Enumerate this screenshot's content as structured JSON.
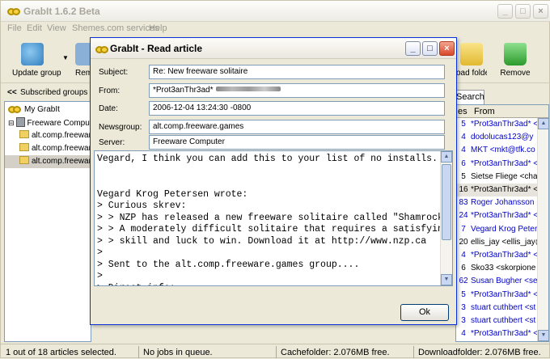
{
  "app": {
    "title": "GrabIt 1.6.2 Beta",
    "menu": [
      "File",
      "Edit",
      "View",
      "Shemes.com services",
      "Help"
    ],
    "toolbar": {
      "update_group": "Update group",
      "remove_partial": "Remo",
      "load_folder": "oad folder",
      "remove": "Remove"
    },
    "left_header": "Subscribed groups",
    "left_header_arrows": "<<",
    "tree": {
      "root": "My GrabIt",
      "server": "Freeware Compute",
      "groups": [
        "alt.comp.freeware",
        "alt.comp.freeware",
        "alt.comp.freeware"
      ]
    },
    "right_tab": "Search",
    "list_headers": {
      "count": "es",
      "from": "From"
    },
    "list_rows": [
      {
        "n": "5",
        "from": "*Prot3anThr3ad* <"
      },
      {
        "n": "4",
        "from": "dodolucas123@y"
      },
      {
        "n": "4",
        "from": "MKT <mkt@tfk.co"
      },
      {
        "n": "6",
        "from": "*Prot3anThr3ad* <"
      },
      {
        "n": "5",
        "from": "Sietse Fliege <cha"
      },
      {
        "n": "16",
        "from": "*Prot3anThr3ad* <"
      },
      {
        "n": "83",
        "from": "Roger Johansson"
      },
      {
        "n": "24",
        "from": "*Prot3anThr3ad* <"
      },
      {
        "n": "7",
        "from": "Vegard Krog Peter"
      },
      {
        "n": "20",
        "from": "ellis_jay <ellis_jay@"
      },
      {
        "n": "4",
        "from": "*Prot3anThr3ad* <"
      },
      {
        "n": "6",
        "from": "Sko33 <skorpione"
      },
      {
        "n": "62",
        "from": "Susan Bugher <se"
      },
      {
        "n": "5",
        "from": "*Prot3anThr3ad* <"
      },
      {
        "n": "3",
        "from": "stuart cuthbert <st"
      },
      {
        "n": "3",
        "from": "stuart cuthbert <st"
      },
      {
        "n": "4",
        "from": "*Prot3anThr3ad* <"
      }
    ],
    "status": {
      "selection": "1 out of 18 articles selected.",
      "jobs": "No jobs in queue.",
      "cache": "Cachefolder: 2.076MB free.",
      "download": "Downloadfolder: 2.076MB free."
    }
  },
  "dialog": {
    "title": "GrabIt - Read article",
    "fields": {
      "subject_label": "Subject:",
      "subject": "Re: New freeware solitaire",
      "from_label": "From:",
      "from": "*Prot3anThr3ad*",
      "date_label": "Date:",
      "date": "2006-12-04 13:24:30 -0800",
      "newsgroup_label": "Newsgroup:",
      "newsgroup": "alt.comp.freeware.games",
      "server_label": "Server:",
      "server": "Freeware Computer"
    },
    "body_lines": [
      "Vegard, I think you can add this to your list of no installs.",
      "",
      "",
      "Vegard Krog Petersen wrote:",
      "> Curious skrev:",
      "> > NZP has released a new freeware solitaire called \"Shamrock",
      "> > A moderately difficult solitaire that requires a satisfyin",
      "> > skill and luck to win. Download it at http://www.nzp.ca",
      ">",
      "> Sent to the alt.comp.freeware.games group....",
      ">",
      "> Direct info:"
    ],
    "ok_label": "Ok"
  }
}
